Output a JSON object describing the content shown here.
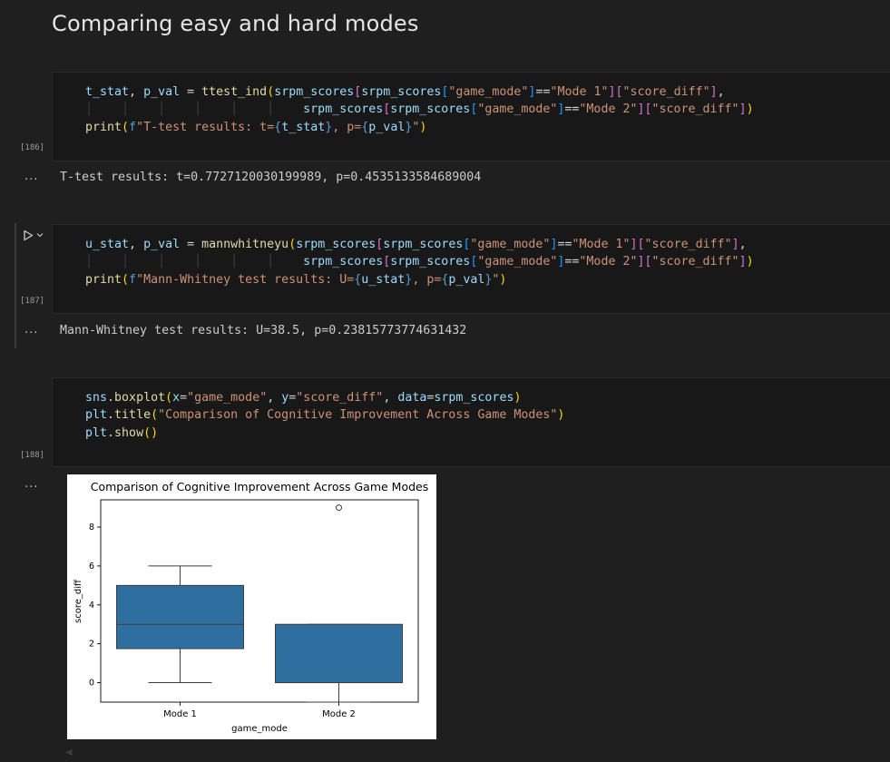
{
  "heading": "Comparing easy and hard modes",
  "cells": [
    {
      "exec_count": "[186]",
      "lines": [
        "t_stat, p_val = ttest_ind(srpm_scores[srpm_scores[\"game_mode\"]==\"Mode 1\"][\"score_diff\"],",
        "                          srpm_scores[srpm_scores[\"game_mode\"]==\"Mode 2\"][\"score_diff\"])",
        "print(f\"T-test results: t={t_stat}, p={p_val}\")"
      ],
      "output": "T-test results: t=0.7727120030199989, p=0.4535133584689004"
    },
    {
      "exec_count": "[187]",
      "lines": [
        "u_stat, p_val = mannwhitneyu(srpm_scores[srpm_scores[\"game_mode\"]==\"Mode 1\"][\"score_diff\"],",
        "                             srpm_scores[srpm_scores[\"game_mode\"]==\"Mode 2\"][\"score_diff\"])",
        "print(f\"Mann-Whitney test results: U={u_stat}, p={p_val}\")"
      ],
      "output": "Mann-Whitney test results: U=38.5, p=0.23815773774631432"
    },
    {
      "exec_count": "[188]",
      "lines": [
        "sns.boxplot(x=\"game_mode\", y=\"score_diff\", data=srpm_scores)",
        "plt.title(\"Comparison of Cognitive Improvement Across Game Modes\")",
        "plt.show()"
      ],
      "output_dots": "..."
    }
  ],
  "output_dots": "...",
  "colors": {
    "box_fill": "#2f6f9f",
    "editor_bg": "#181818",
    "page_bg": "#1f1f1f"
  },
  "chart_data": {
    "type": "box",
    "title": "Comparison of Cognitive Improvement Across Game Modes",
    "xlabel": "game_mode",
    "ylabel": "score_diff",
    "categories": [
      "Mode 1",
      "Mode 2"
    ],
    "yticks": [
      "0",
      "2",
      "4",
      "6",
      "8"
    ],
    "ylim": [
      -1.0,
      9.4
    ],
    "boxes": [
      {
        "category": "Mode 1",
        "whisker_low": 0,
        "q1": 1.75,
        "median": 3,
        "q3": 5,
        "whisker_high": 6,
        "outliers": []
      },
      {
        "category": "Mode 2",
        "whisker_low": -1,
        "q1": 0,
        "median": 0,
        "q3": 3,
        "whisker_high": 3,
        "outliers": [
          9
        ]
      }
    ]
  }
}
